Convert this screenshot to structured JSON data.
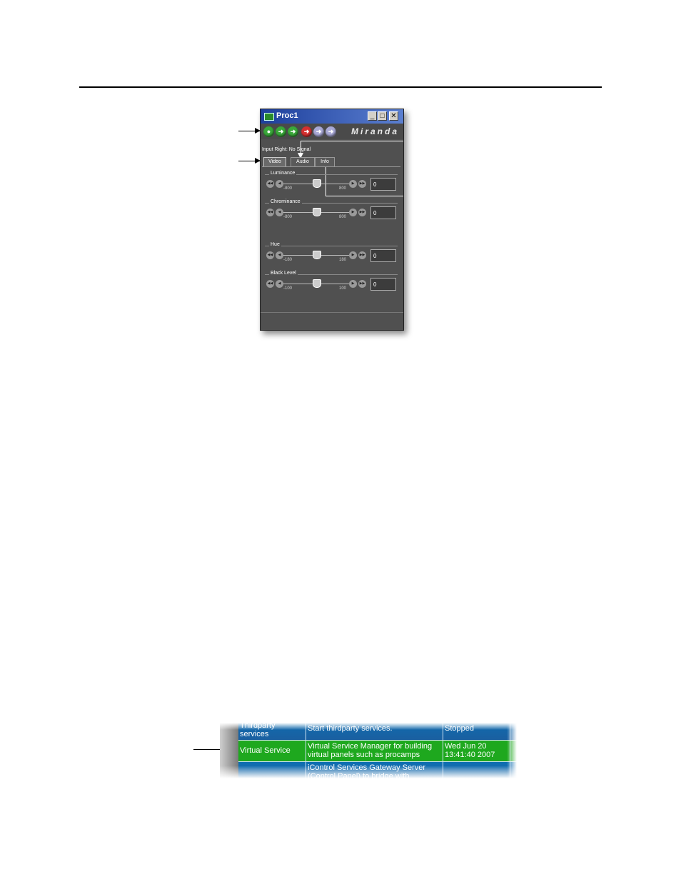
{
  "window": {
    "title": "Proc1",
    "minimize": "_",
    "maximize": "□",
    "close": "✕",
    "logo": "Miranda",
    "input_status": "Input Right: No Signal",
    "toolbar_icons": [
      "status-icon",
      "arrow-right-icon",
      "arrow-right-icon",
      "arrow-right-icon",
      "arrow-right-icon",
      "arrow-right-icon"
    ],
    "tabs": [
      "Video",
      "Audio",
      "Info"
    ],
    "active_tab": "Video",
    "controls": [
      {
        "label": "Luminance",
        "min": "-800",
        "max": "800",
        "value": "0",
        "level": 0.5
      },
      {
        "label": "Chrominance",
        "min": "-800",
        "max": "800",
        "value": "0",
        "level": 0.5
      },
      {
        "label": "Hue",
        "min": "-180",
        "max": "180",
        "value": "0",
        "level": 0.5
      },
      {
        "label": "Black Level",
        "min": "-100",
        "max": "100",
        "value": "0",
        "level": 0.5
      }
    ]
  },
  "services_table": {
    "rows": [
      {
        "name": "Thirdparty services",
        "description": "Start thirdparty services.",
        "status": "Stopped",
        "color": "#0e6fb2"
      },
      {
        "name": "Virtual Service",
        "description": "Virtual Service Manager for building virtual panels such as procamps",
        "status": "Wed Jun 20 13:41:40 2007",
        "color": "#1ea81e"
      },
      {
        "name": "",
        "description": "iControl Services Gateway Server (Control Panel) to bridge with",
        "status": "",
        "color": "#0e6fb2"
      }
    ]
  }
}
